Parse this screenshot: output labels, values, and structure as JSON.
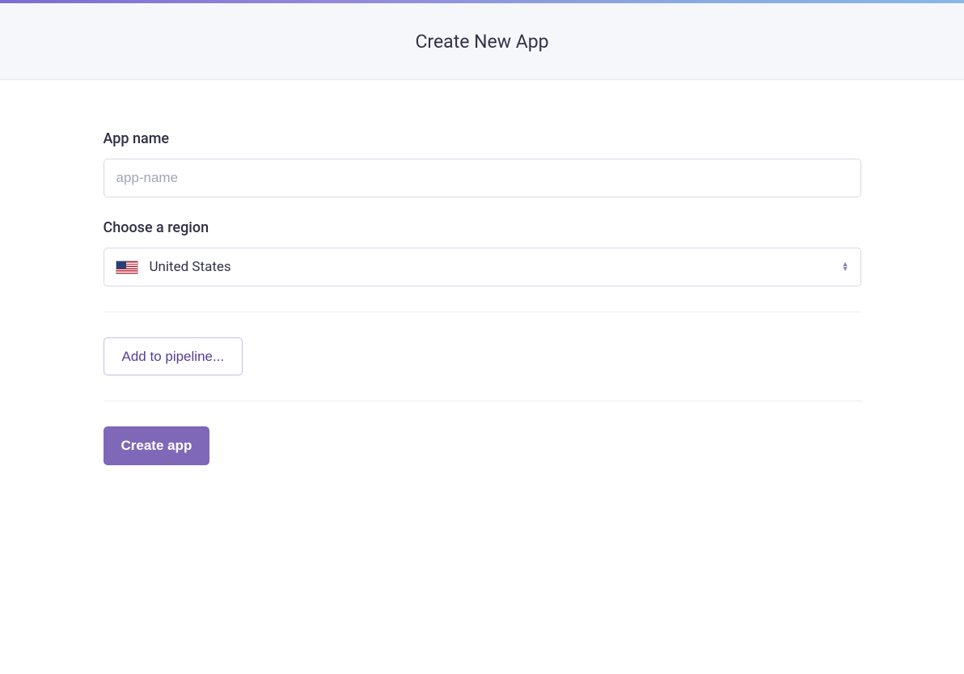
{
  "header": {
    "title": "Create New App"
  },
  "form": {
    "appName": {
      "label": "App name",
      "placeholder": "app-name",
      "value": ""
    },
    "region": {
      "label": "Choose a region",
      "selected": "United States",
      "flag": "us"
    },
    "pipelineButton": "Add to pipeline...",
    "submitButton": "Create app"
  }
}
